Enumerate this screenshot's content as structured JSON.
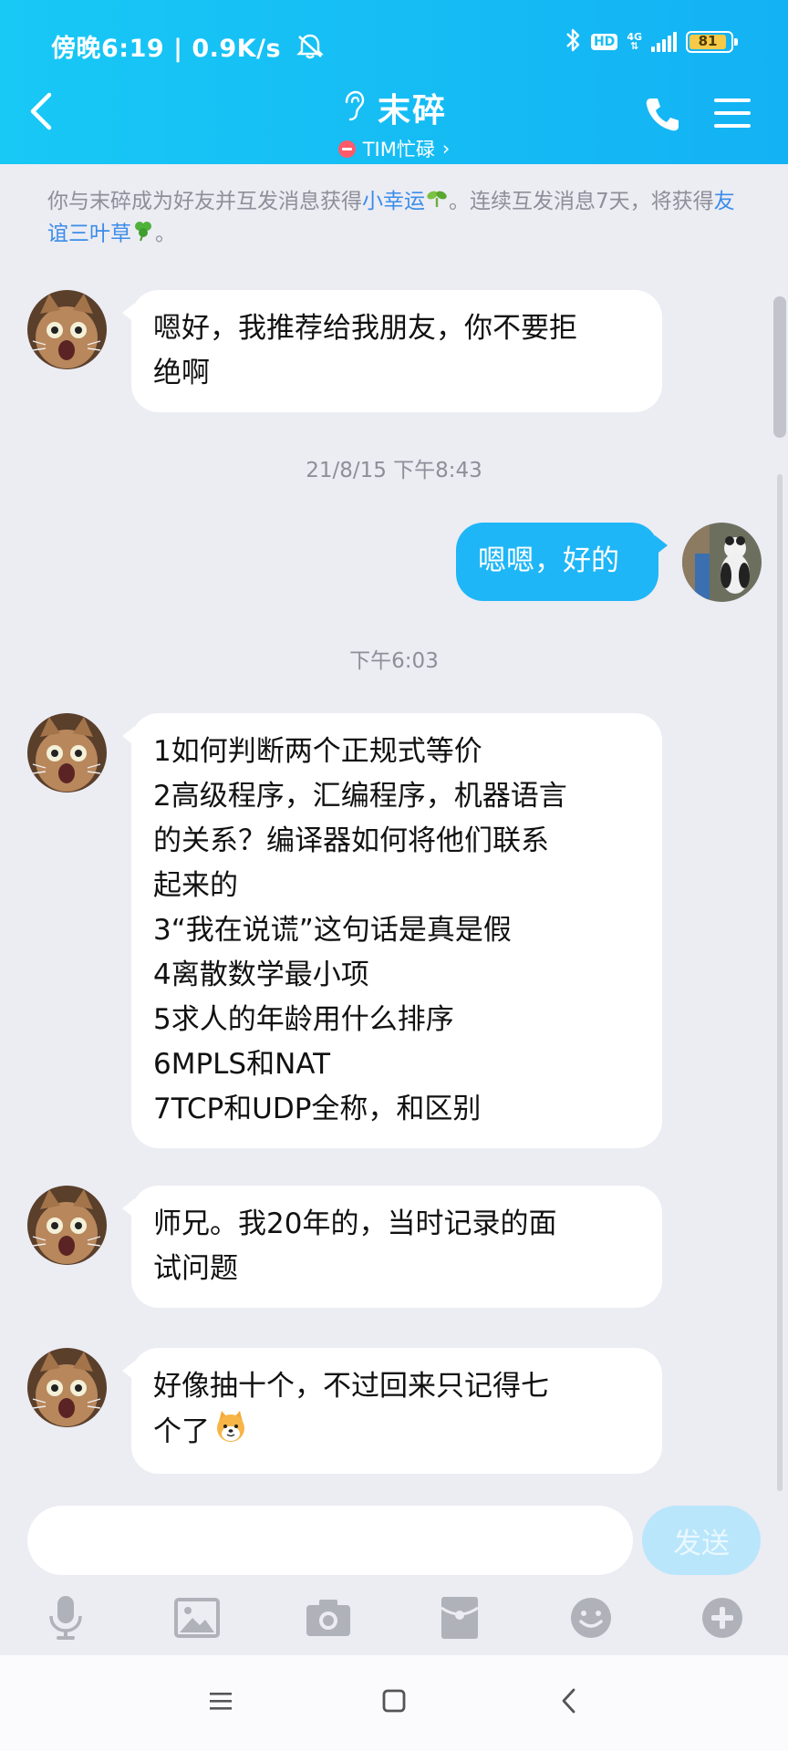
{
  "statusbar": {
    "time": "傍晚6:19",
    "speed": "0.9K/s",
    "hd": "HD",
    "net": "4G",
    "battery": "81"
  },
  "header": {
    "title": "末碎",
    "subtitle": "TIM忙碌",
    "subtitle_arrow": "›"
  },
  "notice": {
    "part1": "你与末碎成为好友并互发消息获得",
    "link1": "小幸运",
    "part2": "。连续互发消息7天，将获得",
    "link2": "友谊三叶草",
    "part3": "。"
  },
  "messages": [
    {
      "from": "other",
      "lines": [
        "嗯好，我推荐给我朋友，你不要拒",
        "绝啊"
      ]
    },
    {
      "timestamp": "21/8/15 下午8:43"
    },
    {
      "from": "self",
      "lines": [
        "嗯嗯，好的"
      ]
    },
    {
      "timestamp": "下午6:03"
    },
    {
      "from": "other",
      "lines": [
        "1如何判断两个正规式等价",
        "2高级程序，汇编程序，机器语言",
        "的关系？编译器如何将他们联系",
        "起来的",
        "3“我在说谎”这句话是真是假",
        "4离散数学最小项",
        "5求人的年龄用什么排序",
        "6MPLS和NAT",
        "7TCP和UDP全称，和区别"
      ]
    },
    {
      "from": "other",
      "lines": [
        "师兄。我20年的，当时记录的面",
        "试问题"
      ]
    },
    {
      "from": "other",
      "lines": [
        "好像抽十个，不过回来只记得七",
        "个了"
      ],
      "emoji": "dog-face-emoji"
    }
  ],
  "input": {
    "placeholder": "",
    "send_label": "发送"
  },
  "toolbar": {
    "items": [
      "microphone-icon",
      "image-icon",
      "camera-icon",
      "red-packet-icon",
      "emoji-icon",
      "plus-icon"
    ]
  },
  "colors": {
    "header_start": "#18c8f5",
    "header_end": "#13b2f4",
    "self_bubble": "#1fb6f7",
    "link": "#3a8dea",
    "background": "#ececf3"
  }
}
